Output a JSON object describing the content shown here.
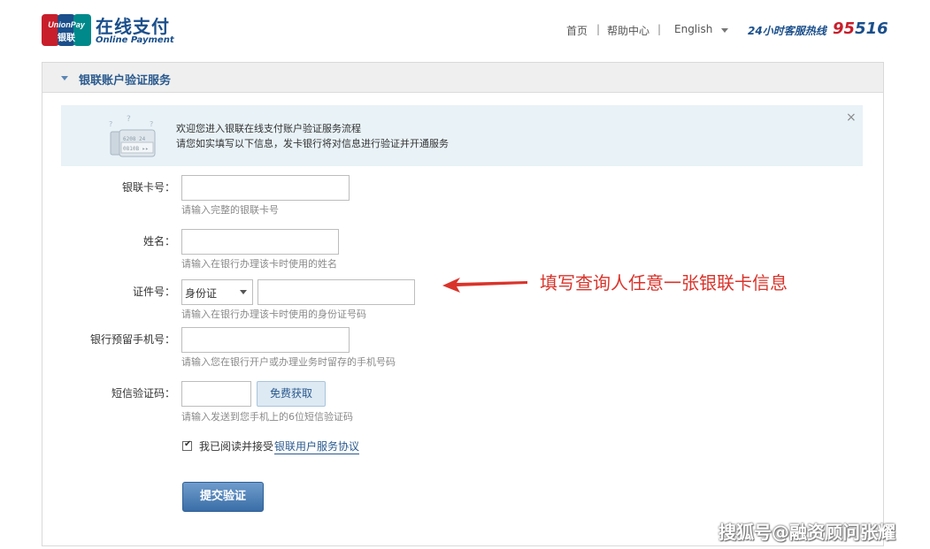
{
  "header": {
    "logo_badge_text": "UnionPay",
    "logo_cn": "在线支付",
    "logo_en": "Online Payment",
    "nav": {
      "home": "首页",
      "help": "帮助中心",
      "language": "English",
      "separator": "|"
    },
    "hotline_label": "24小时客服热线",
    "hotline_number_part1": "95",
    "hotline_number_part2": "516"
  },
  "panel": {
    "title": "银联账户验证服务",
    "notice": {
      "line1": "欢迎您进入银联在线支付账户验证服务流程",
      "line2": "请您如实填写以下信息，发卡银行将对信息进行验证并开通服务",
      "close": "×"
    }
  },
  "form": {
    "card_number": {
      "label": "银联卡号：",
      "hint": "请输入完整的银联卡号",
      "value": ""
    },
    "name": {
      "label": "姓名：",
      "hint": "请输入在银行办理该卡时使用的姓名",
      "value": ""
    },
    "id": {
      "label": "证件号：",
      "type_selected": "身份证",
      "hint": "请输入在银行办理该卡时使用的身份证号码",
      "value": ""
    },
    "phone": {
      "label": "银行预留手机号：",
      "hint": "请输入您在银行开户或办理业务时留存的手机号码",
      "value": ""
    },
    "sms": {
      "label": "短信验证码：",
      "button": "免费获取",
      "hint": "请输入发送到您手机上的6位短信验证码",
      "value": ""
    },
    "agreement": {
      "checked": true,
      "text": "我已阅读并接受",
      "link": "银联用户服务协议"
    },
    "submit": "提交验证"
  },
  "annotation": {
    "text": "填写查询人任意一张银联卡信息",
    "color": "#d9342b"
  },
  "watermark": "搜狐号@融资顾问张耀",
  "colors": {
    "brand_blue": "#1a4f8b",
    "brand_red": "#c81e2b"
  }
}
